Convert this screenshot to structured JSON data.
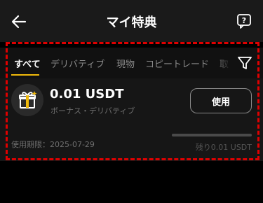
{
  "header": {
    "title": "マイ特典"
  },
  "tabs": [
    {
      "label": "すべて",
      "active": true
    },
    {
      "label": "デリバティブ",
      "active": false
    },
    {
      "label": "現物",
      "active": false
    },
    {
      "label": "コピートレード",
      "active": false
    },
    {
      "label": "取",
      "active": false
    }
  ],
  "coupon": {
    "amount": "0.01 USDT",
    "subtitle": "ボーナス・デリバティブ",
    "use_label": "使用",
    "expiry": "使用期限：2025-07-29",
    "remaining": "残り0.01 USDT",
    "remaining_fraction": 1.0
  },
  "colors": {
    "accent": "#f0b90b",
    "highlight_border": "#e00000"
  },
  "icons": {
    "back": "arrow-left-icon",
    "help": "help-icon",
    "filter": "filter-icon",
    "gift": "gift-icon"
  }
}
